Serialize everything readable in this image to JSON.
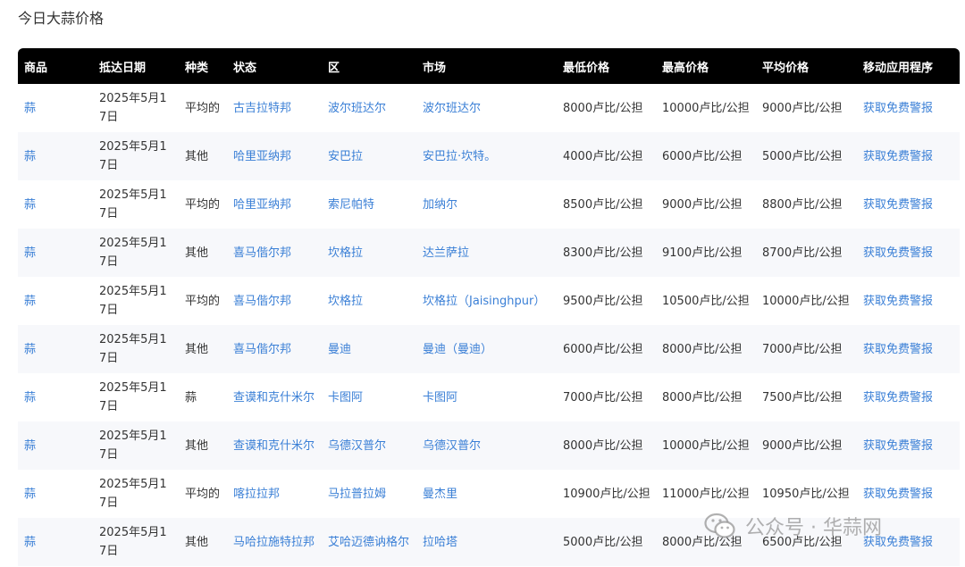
{
  "page": {
    "title": "今日大蒜价格"
  },
  "table": {
    "headers": [
      "商品",
      "抵达日期",
      "种类",
      "状态",
      "区",
      "市场",
      "最低价格",
      "最高价格",
      "平均价格",
      "移动应用程序"
    ],
    "rows": [
      {
        "commodity": "蒜",
        "date": "2025年5月17日",
        "variety": "平均的",
        "state": "古吉拉特邦",
        "district": "波尔班达尔",
        "market": "波尔班达尔",
        "min": "8000卢比/公担",
        "max": "10000卢比/公担",
        "avg": "9000卢比/公担",
        "app": "获取免费警报"
      },
      {
        "commodity": "蒜",
        "date": "2025年5月17日",
        "variety": "其他",
        "state": "哈里亚纳邦",
        "district": "安巴拉",
        "market": "安巴拉·坎特。",
        "min": "4000卢比/公担",
        "max": "6000卢比/公担",
        "avg": "5000卢比/公担",
        "app": "获取免费警报"
      },
      {
        "commodity": "蒜",
        "date": "2025年5月17日",
        "variety": "平均的",
        "state": "哈里亚纳邦",
        "district": "索尼帕特",
        "market": "加纳尔",
        "min": "8500卢比/公担",
        "max": "9000卢比/公担",
        "avg": "8800卢比/公担",
        "app": "获取免费警报"
      },
      {
        "commodity": "蒜",
        "date": "2025年5月17日",
        "variety": "其他",
        "state": "喜马偕尔邦",
        "district": "坎格拉",
        "market": "达兰萨拉",
        "min": "8300卢比/公担",
        "max": "9100卢比/公担",
        "avg": "8700卢比/公担",
        "app": "获取免费警报"
      },
      {
        "commodity": "蒜",
        "date": "2025年5月17日",
        "variety": "平均的",
        "state": "喜马偕尔邦",
        "district": "坎格拉",
        "market": "坎格拉（Jaisinghpur）",
        "min": "9500卢比/公担",
        "max": "10500卢比/公担",
        "avg": "10000卢比/公担",
        "app": "获取免费警报"
      },
      {
        "commodity": "蒜",
        "date": "2025年5月17日",
        "variety": "其他",
        "state": "喜马偕尔邦",
        "district": "曼迪",
        "market": "曼迪（曼迪）",
        "min": "6000卢比/公担",
        "max": "8000卢比/公担",
        "avg": "7000卢比/公担",
        "app": "获取免费警报"
      },
      {
        "commodity": "蒜",
        "date": "2025年5月17日",
        "variety": "蒜",
        "state": "查谟和克什米尔",
        "district": "卡图阿",
        "market": "卡图阿",
        "min": "7000卢比/公担",
        "max": "8000卢比/公担",
        "avg": "7500卢比/公担",
        "app": "获取免费警报"
      },
      {
        "commodity": "蒜",
        "date": "2025年5月17日",
        "variety": "其他",
        "state": "查谟和克什米尔",
        "district": "乌德汉普尔",
        "market": "乌德汉普尔",
        "min": "8000卢比/公担",
        "max": "10000卢比/公担",
        "avg": "9000卢比/公担",
        "app": "获取免费警报"
      },
      {
        "commodity": "蒜",
        "date": "2025年5月17日",
        "variety": "平均的",
        "state": "喀拉拉邦",
        "district": "马拉普拉姆",
        "market": "曼杰里",
        "min": "10900卢比/公担",
        "max": "11000卢比/公担",
        "avg": "10950卢比/公担",
        "app": "获取免费警报"
      },
      {
        "commodity": "蒜",
        "date": "2025年5月17日",
        "variety": "其他",
        "state": "马哈拉施特拉邦",
        "district": "艾哈迈德讷格尔",
        "market": "拉哈塔",
        "min": "5000卢比/公担",
        "max": "8000卢比/公担",
        "avg": "6500卢比/公担",
        "app": "获取免费警报"
      }
    ]
  },
  "watermark": {
    "icon": "wechat-icon",
    "text": "公众号 · 华蒜网"
  }
}
